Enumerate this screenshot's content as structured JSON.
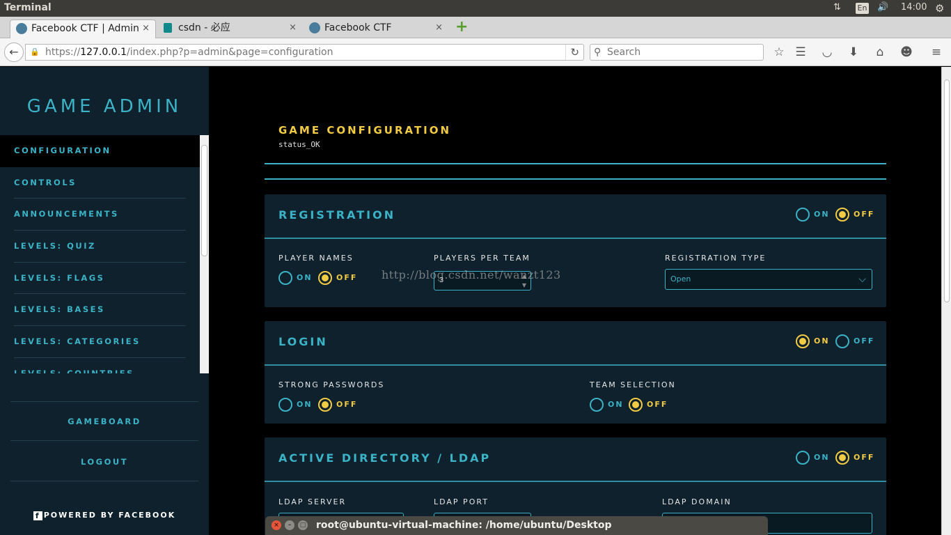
{
  "os": {
    "title": "Terminal",
    "lang": "En",
    "time": "14:00"
  },
  "browser": {
    "tabs": [
      {
        "label": "Facebook CTF | Admin",
        "close": "×"
      },
      {
        "label": "csdn - 必应",
        "close": "×"
      },
      {
        "label": "Facebook CTF",
        "close": "×"
      }
    ],
    "new_tab": "+",
    "url_protocol": "https://",
    "url_host": "127.0.0.1",
    "url_path": "/index.php?p=admin&page=configuration",
    "search_placeholder": "Search"
  },
  "sidebar": {
    "brand": "GAME ADMIN",
    "items": [
      {
        "label": "CONFIGURATION"
      },
      {
        "label": "CONTROLS"
      },
      {
        "label": "ANNOUNCEMENTS"
      },
      {
        "label": "LEVELS: QUIZ"
      },
      {
        "label": "LEVELS: FLAGS"
      },
      {
        "label": "LEVELS: BASES"
      },
      {
        "label": "LEVELS: CATEGORIES"
      },
      {
        "label": "LEVELS: COUNTRIES"
      }
    ],
    "gameboard": "GAMEBOARD",
    "logout": "LOGOUT",
    "powered": "POWERED BY FACEBOOK"
  },
  "main": {
    "title": "GAME CONFIGURATION",
    "status": "status_OK",
    "registration": {
      "title": "REGISTRATION",
      "on": "ON",
      "off": "OFF",
      "player_names_label": "PLAYER NAMES",
      "players_per_team_label": "PLAYERS PER TEAM",
      "players_per_team_value": "3",
      "registration_type_label": "REGISTRATION TYPE",
      "registration_type_value": "Open"
    },
    "login": {
      "title": "LOGIN",
      "on": "ON",
      "off": "OFF",
      "strong_passwords_label": "STRONG PASSWORDS",
      "team_selection_label": "TEAM SELECTION"
    },
    "ldap": {
      "title": "ACTIVE DIRECTORY / LDAP",
      "on": "ON",
      "off": "OFF",
      "server_label": "LDAP SERVER",
      "port_label": "LDAP PORT",
      "domain_label": "LDAP DOMAIN"
    }
  },
  "watermark": "http://blog.csdn.net/wanzt123",
  "terminal": {
    "title": "root@ubuntu-virtual-machine: /home/ubuntu/Desktop"
  }
}
